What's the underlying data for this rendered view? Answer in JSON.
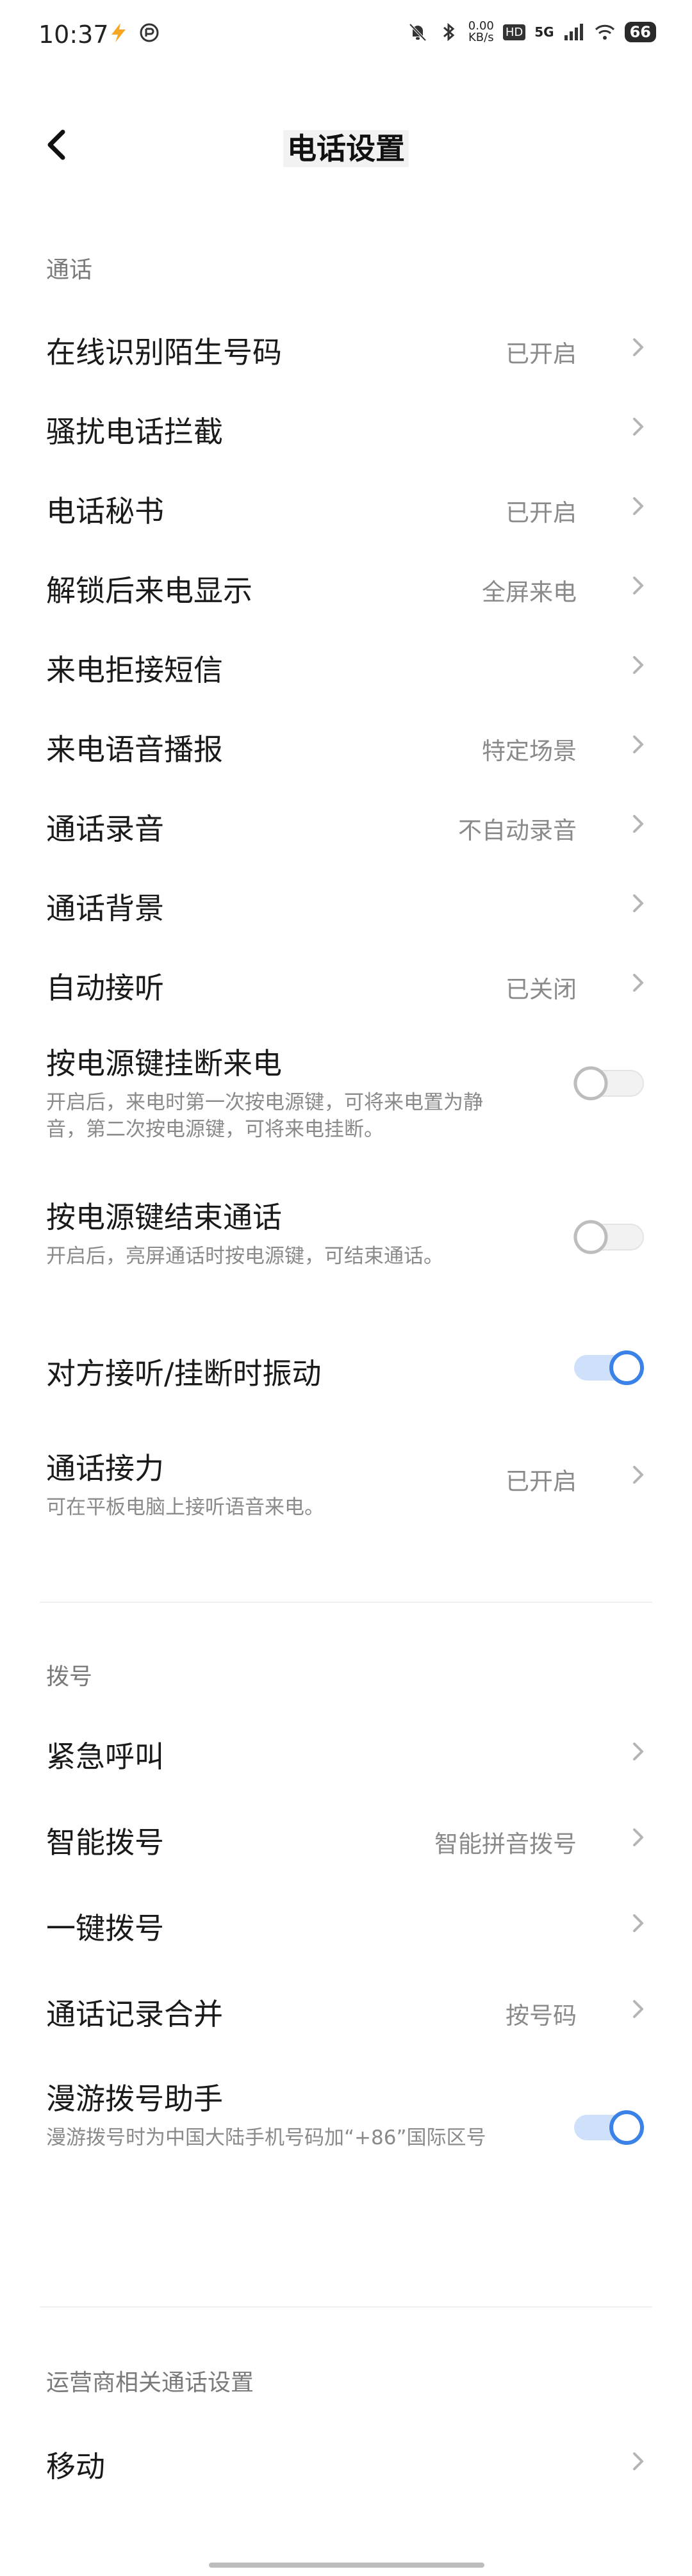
{
  "status_bar": {
    "time": "10:37",
    "net_speed_value": "0.00",
    "net_speed_unit": "KB/s",
    "hd_label": "HD",
    "signal_label": "5G",
    "battery": "66"
  },
  "header": {
    "title": "电话设置"
  },
  "sections": {
    "call": {
      "label": "通话",
      "rows": [
        {
          "title": "在线识别陌生号码",
          "value": "已开启"
        },
        {
          "title": "骚扰电话拦截",
          "value": ""
        },
        {
          "title": "电话秘书",
          "value": "已开启"
        },
        {
          "title": "解锁后来电显示",
          "value": "全屏来电"
        },
        {
          "title": "来电拒接短信",
          "value": ""
        },
        {
          "title": "来电语音播报",
          "value": "特定场景"
        },
        {
          "title": "通话录音",
          "value": "不自动录音"
        },
        {
          "title": "通话背景",
          "value": ""
        },
        {
          "title": "自动接听",
          "value": "已关闭"
        }
      ],
      "power_hangup": {
        "title": "按电源键挂断来电",
        "desc": "开启后，来电时第一次按电源键，可将来电置为静音，第二次按电源键，可将来电挂断。",
        "on": false
      },
      "power_end": {
        "title": "按电源键结束通话",
        "desc": "开启后，亮屏通话时按电源键，可结束通话。",
        "on": false
      },
      "vibrate": {
        "title": "对方接听/挂断时振动",
        "on": true
      },
      "relay": {
        "title": "通话接力",
        "desc": "可在平板电脑上接听语音来电。",
        "value": "已开启"
      }
    },
    "dial": {
      "label": "拨号",
      "rows": [
        {
          "title": "紧急呼叫",
          "value": ""
        },
        {
          "title": "智能拨号",
          "value": "智能拼音拨号"
        },
        {
          "title": "一键拨号",
          "value": ""
        },
        {
          "title": "通话记录合并",
          "value": "按号码"
        }
      ],
      "roaming": {
        "title": "漫游拨号助手",
        "desc": "漫游拨号时为中国大陆手机号码加“+86”国际区号",
        "on": true
      }
    },
    "carrier": {
      "label": "运营商相关通话设置",
      "rows": [
        {
          "title": "移动",
          "value": ""
        }
      ]
    }
  },
  "colors": {
    "accent": "#3b82e8",
    "switch_track_on": "#cfe0fa",
    "switch_track_off": "#f2f2f2",
    "secondary_text": "#8a8a8a"
  }
}
